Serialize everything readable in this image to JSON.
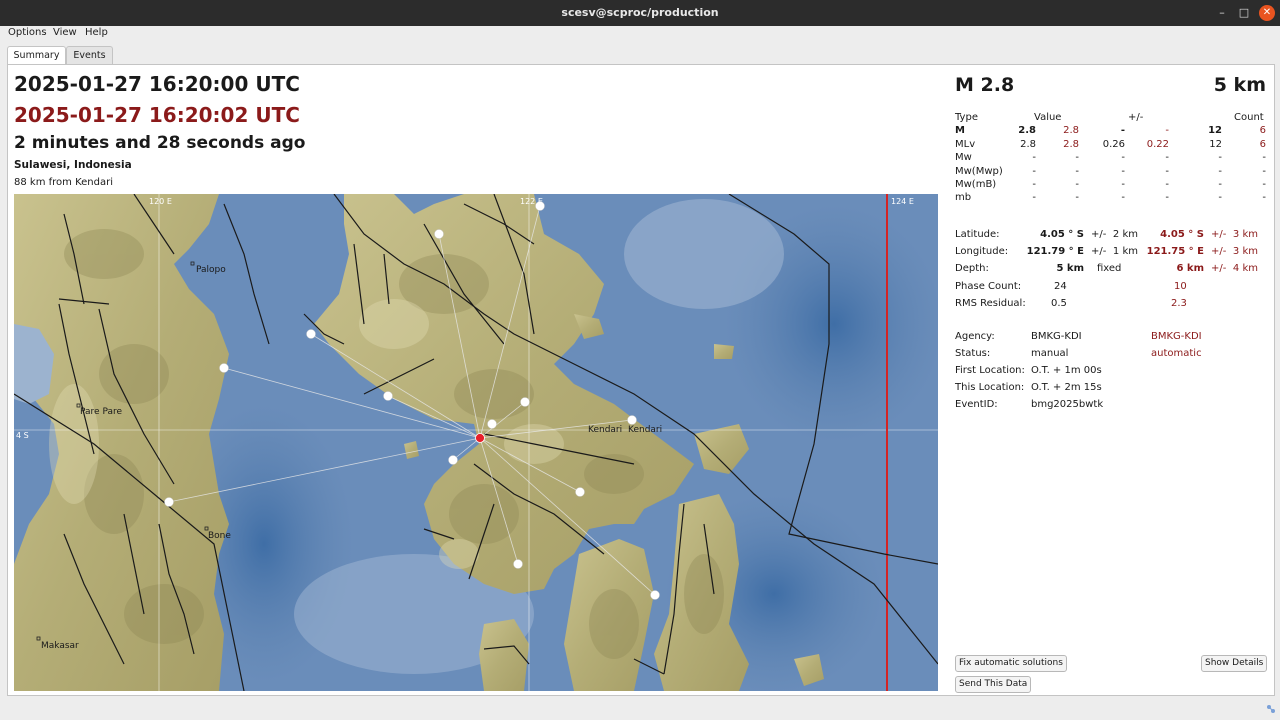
{
  "window": {
    "title": "scesv@scproc/production"
  },
  "menu": {
    "options": "Options",
    "view": "View",
    "help": "Help"
  },
  "tabs": {
    "summary": "Summary",
    "events": "Events"
  },
  "origin": {
    "time": "2025-01-27 16:20:00 UTC",
    "time_auto": "2025-01-27 16:20:02 UTC",
    "ago": "2 minutes and 28 seconds ago",
    "region": "Sulawesi, Indonesia",
    "nearest": "88 km from Kendari"
  },
  "summary": {
    "magnitude": "M 2.8",
    "depth": "5 km"
  },
  "mag_table": {
    "headers": {
      "type": "Type",
      "value": "Value",
      "uncert": "+/-",
      "count": "Count"
    },
    "rows": [
      {
        "type": "M",
        "v": "2.8",
        "va": "2.8",
        "u": "-",
        "ua": "-",
        "c": "12",
        "ca": "6"
      },
      {
        "type": "MLv",
        "v": "2.8",
        "va": "2.8",
        "u": "0.26",
        "ua": "0.22",
        "c": "12",
        "ca": "6"
      },
      {
        "type": "Mw",
        "v": "-",
        "va": "-",
        "u": "-",
        "ua": "-",
        "c": "-",
        "ca": "-"
      },
      {
        "type": "Mw(Mwp)",
        "v": "-",
        "va": "-",
        "u": "-",
        "ua": "-",
        "c": "-",
        "ca": "-"
      },
      {
        "type": "Mw(mB)",
        "v": "-",
        "va": "-",
        "u": "-",
        "ua": "-",
        "c": "-",
        "ca": "-"
      },
      {
        "type": "mb",
        "v": "-",
        "va": "-",
        "u": "-",
        "ua": "-",
        "c": "-",
        "ca": "-"
      }
    ]
  },
  "location": {
    "latitude": {
      "label": "Latitude:",
      "value": "4.05 ° S",
      "pm": "+/-",
      "unc": "2 km",
      "value_auto": "4.05 ° S",
      "unc_auto": "3 km"
    },
    "longitude": {
      "label": "Longitude:",
      "value": "121.79 ° E",
      "pm": "+/-",
      "unc": "1 km",
      "value_auto": "121.75 ° E",
      "unc_auto": "3 km"
    },
    "depth": {
      "label": "Depth:",
      "value": "5 km",
      "status": "fixed",
      "value_auto": "6 km",
      "pm": "+/-",
      "unc_auto": "4 km"
    },
    "phase_count": {
      "label": "Phase Count:",
      "value": "24",
      "value_auto": "10"
    },
    "rms": {
      "label": "RMS Residual:",
      "value": "0.5",
      "value_auto": "2.3"
    }
  },
  "info": {
    "agency": {
      "label": "Agency:",
      "value": "BMKG-KDI",
      "value_auto": "BMKG-KDI"
    },
    "status": {
      "label": "Status:",
      "value": "manual",
      "value_auto": "automatic"
    },
    "first_location": {
      "label": "First Location:",
      "value": "O.T. + 1m 00s"
    },
    "this_location": {
      "label": "This Location:",
      "value": "O.T. + 2m 15s"
    },
    "event_id": {
      "label": "EventID:",
      "value": "bmg2025bwtk"
    }
  },
  "buttons": {
    "fix_auto": "Fix automatic solutions",
    "show_details": "Show Details",
    "send_data": "Send This Data"
  },
  "map": {
    "grid_labels": {
      "lon120": "120 E",
      "lon122": "122 E",
      "lon124": "124 E",
      "lat4": "4 S"
    },
    "cities": {
      "palopo": "Palopo",
      "parepare": "Pare Pare",
      "bone": "Bone",
      "makasar": "Makasar",
      "kendari1": "Kendari",
      "kendari2": "Kendari"
    },
    "colors": {
      "sea": "#5d82b0",
      "land": "#b9b27c",
      "epicenter": "#e8202a",
      "meridian": "#d42424"
    }
  }
}
